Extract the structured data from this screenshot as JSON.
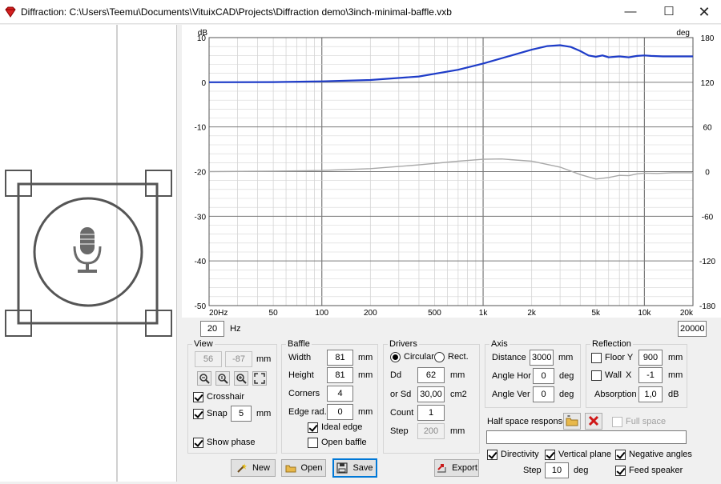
{
  "window": {
    "title": "Diffraction: C:\\Users\\Teemu\\Documents\\VituixCAD\\Projects\\Diffraction demo\\3inch-minimal-baffle.vxb"
  },
  "plot": {
    "left_unit": "dB",
    "right_unit": "deg",
    "y_ticks": [
      "10",
      "0",
      "-10",
      "-20",
      "-30",
      "-40",
      "-50"
    ],
    "phase_ticks": [
      "180",
      "120",
      "60",
      "0",
      "-60",
      "-120",
      "-180"
    ],
    "x_ticks": [
      "20Hz",
      "50",
      "100",
      "200",
      "500",
      "1k",
      "2k",
      "5k",
      "10k",
      "20k"
    ],
    "fmin": "20",
    "fmin_unit": "Hz",
    "fmax": "20000",
    "colors": {
      "magnitude": "#1e3cc8",
      "phase": "#a8a8a8",
      "grid": "#d4d4d4",
      "grid_major": "#7a7a7a"
    }
  },
  "view": {
    "title": "View",
    "x": "56",
    "y": "-87",
    "unit": "mm",
    "crosshair_label": "Crosshair",
    "crosshair": true,
    "snap_label": "Snap",
    "snap": true,
    "snap_value": "5",
    "snap_unit": "mm",
    "show_phase_label": "Show phase",
    "show_phase": true
  },
  "baffle": {
    "title": "Baffle",
    "width_label": "Width",
    "width": "81",
    "width_unit": "mm",
    "height_label": "Height",
    "height": "81",
    "height_unit": "mm",
    "corners_label": "Corners",
    "corners": "4",
    "edge_label": "Edge rad.",
    "edge": "0",
    "edge_unit": "mm",
    "ideal_edge_label": "Ideal edge",
    "ideal_edge": true,
    "open_baffle_label": "Open baffle",
    "open_baffle": false
  },
  "drivers": {
    "title": "Drivers",
    "circular_label": "Circular",
    "rect_label": "Rect.",
    "dd_label": "Dd",
    "dd": "62",
    "dd_unit": "mm",
    "sd_label": "or Sd",
    "sd": "30,00",
    "sd_unit": "cm2",
    "count_label": "Count",
    "count": "1",
    "step_label": "Step",
    "step": "200",
    "step_unit": "mm"
  },
  "axis": {
    "title": "Axis",
    "distance_label": "Distance",
    "distance": "3000",
    "distance_unit": "mm",
    "hor_label": "Angle Hor",
    "hor": "0",
    "hor_unit": "deg",
    "ver_label": "Angle Ver",
    "ver": "0",
    "ver_unit": "deg"
  },
  "reflection": {
    "title": "Reflection",
    "floor_label": "Floor Y",
    "floor": "900",
    "floor_unit": "mm",
    "wall_label": "Wall",
    "wall_axis": "X",
    "wall": "-1",
    "wall_unit": "mm",
    "absorption_label": "Absorption",
    "absorption": "1,0",
    "absorption_unit": "dB"
  },
  "half_space": {
    "label": "Half space response",
    "full_space_label": "Full space",
    "path": ""
  },
  "options": {
    "directivity_label": "Directivity",
    "vertical_plane_label": "Vertical plane",
    "negative_angles_label": "Negative angles",
    "step_label": "Step",
    "step": "10",
    "step_unit": "deg",
    "feed_speaker_label": "Feed speaker"
  },
  "buttons": {
    "new": "New",
    "open": "Open",
    "save": "Save",
    "export": "Export"
  }
}
